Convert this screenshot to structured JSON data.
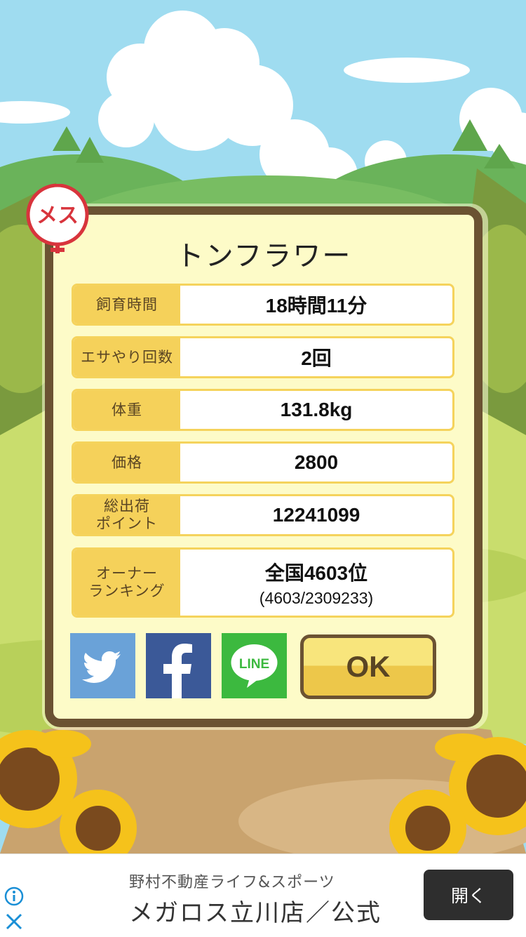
{
  "dialog": {
    "title": "トンフラワー",
    "rows": [
      {
        "label": "飼育時間",
        "value": "18時間11分"
      },
      {
        "label": "エサやり回数",
        "value": "2回"
      },
      {
        "label": "体重",
        "value": "131.8kg"
      },
      {
        "label": "価格",
        "value": "2800"
      },
      {
        "label_line1": "総出荷",
        "label_line2": "ポイント",
        "value": "12241099"
      },
      {
        "label_line1": "オーナー",
        "label_line2": "ランキング",
        "value": "全国4603位",
        "sub": "(4603/2309233)"
      }
    ],
    "gender_badge": "メス",
    "share": {
      "line_label": "LINE"
    },
    "ok_label": "OK"
  },
  "ad": {
    "subtitle": "野村不動産ライフ&スポーツ",
    "title": "メガロス立川店／公式",
    "button": "開く"
  },
  "icons": [
    "female-badge-icon",
    "twitter-icon",
    "facebook-icon",
    "line-icon",
    "info-icon",
    "close-icon"
  ],
  "colors": {
    "frame": "#6b5232",
    "panel": "#fdfbc8",
    "label_bg": "#f5d15a",
    "twitter": "#6aa2d8",
    "facebook": "#3b5998",
    "line": "#3cb93f"
  }
}
